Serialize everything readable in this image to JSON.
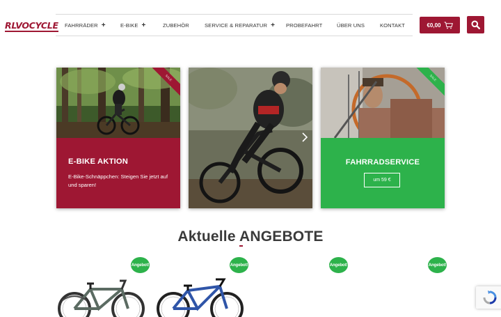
{
  "brand": {
    "logo_text": "RLVOCYCLE",
    "accent": "#9e1733",
    "green": "#2db24b"
  },
  "nav": {
    "items": [
      {
        "label": "FAHRRÄDER",
        "has_submenu": true
      },
      {
        "label": "E-BIKE",
        "has_submenu": true
      },
      {
        "label": "ZUBEHÖR",
        "has_submenu": false
      },
      {
        "label": "SERVICE & REPARATUR",
        "has_submenu": true
      },
      {
        "label": "PROBEFAHRT",
        "has_submenu": false
      },
      {
        "label": "ÜBER UNS",
        "has_submenu": false
      },
      {
        "label": "KONTAKT",
        "has_submenu": false
      }
    ],
    "submenu_indicator": "+"
  },
  "cart": {
    "amount": "€0,00",
    "icon": "cart-icon"
  },
  "search": {
    "icon": "search-icon"
  },
  "promos": {
    "ebike": {
      "title": "E-BIKE AKTION",
      "text": "E-Bike-Schnäppchen: Steigen Sie jetzt auf und sparen!",
      "ribbon_text": "SALE",
      "color": "#9e1733"
    },
    "slider": {
      "arrow_icon": "chevron-right-icon"
    },
    "service": {
      "title": "FAHRRADSERVICE",
      "button_label": "um 59 €",
      "ribbon_text": "SALE",
      "color": "#2db24b"
    }
  },
  "offers": {
    "heading": "Aktuelle ANGEBOTE",
    "badge_label": "Angebot!",
    "products": [
      {
        "image": "trekking-bike-grey"
      },
      {
        "image": "mountain-bike-blue"
      },
      {
        "image": ""
      },
      {
        "image": ""
      }
    ]
  },
  "recaptcha": {
    "icon": "recaptcha-icon"
  }
}
